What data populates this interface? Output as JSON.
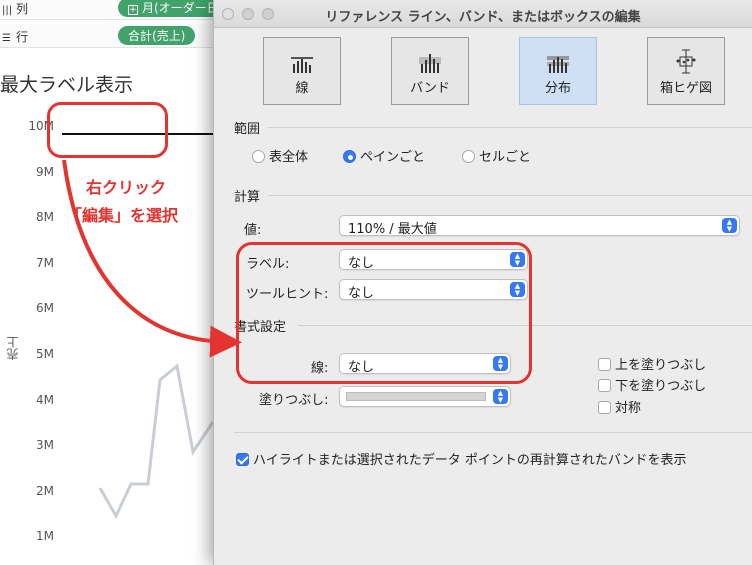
{
  "background": {
    "columns_shelf": {
      "label": "列",
      "pill": "月(オーダー日"
    },
    "rows_shelf": {
      "label": "行",
      "pill": "合計(売上)"
    },
    "sheet_title": "最大ラベル表示",
    "axis_title": "売上",
    "axis_ticks": [
      "10M",
      "9M",
      "8M",
      "7M",
      "6M",
      "5M",
      "4M",
      "3M",
      "2M",
      "1M"
    ],
    "annotation_line1": "右クリック",
    "annotation_line2": "「編集」を選択",
    "colors": {
      "pill": "#41a36b",
      "annotation": "#e3342f",
      "series": "#c9ced6"
    }
  },
  "dialog": {
    "title": "リファレンス ライン、バンド、またはボックスの編集",
    "types": [
      {
        "label": "線",
        "icon": "line-type-icon",
        "active": false
      },
      {
        "label": "バンド",
        "icon": "band-type-icon",
        "active": false
      },
      {
        "label": "分布",
        "icon": "distribution-type-icon",
        "active": true
      },
      {
        "label": "箱ヒゲ図",
        "icon": "boxplot-type-icon",
        "active": false
      }
    ],
    "scope": {
      "heading": "範囲",
      "options": [
        "表全体",
        "ペインごと",
        "セルごと"
      ],
      "selected": "ペインごと"
    },
    "compute": {
      "heading": "計算",
      "value_label": "値:",
      "value": "110% / 最大値",
      "label_label": "ラベル:",
      "label_value": "なし",
      "tooltip_label": "ツールヒント:",
      "tooltip_value": "なし"
    },
    "format": {
      "heading": "書式設定",
      "line_label": "線:",
      "line_value": "なし",
      "fill_label": "塗りつぶし:",
      "fill_above": "上を塗りつぶし",
      "fill_below": "下を塗りつぶし",
      "symmetric": "対称"
    },
    "highlight_checkbox": "ハイライトまたは選択されたデータ ポイントの再計算されたバンドを表示"
  }
}
